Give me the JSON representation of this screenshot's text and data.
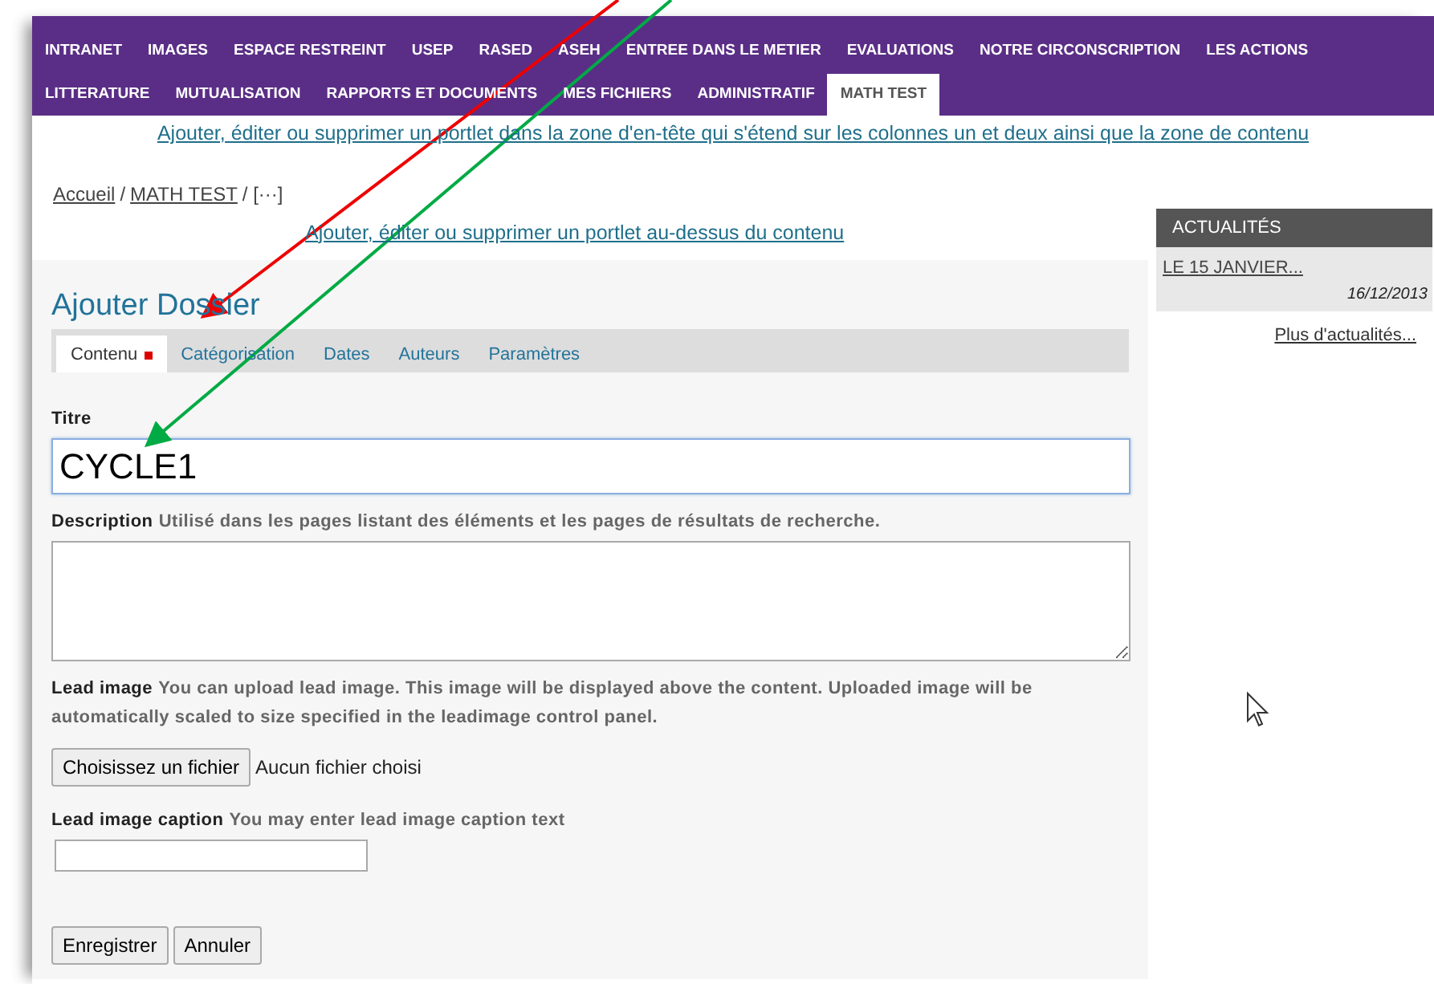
{
  "nav": {
    "row_1": [
      {
        "label": "INTRANET",
        "selected": false
      },
      {
        "label": "IMAGES",
        "selected": false
      },
      {
        "label": "ESPACE RESTREINT",
        "selected": false
      },
      {
        "label": "USEP",
        "selected": false
      },
      {
        "label": "RASED",
        "selected": false
      },
      {
        "label": "ASEH",
        "selected": false
      },
      {
        "label": "ENTREE DANS LE METIER",
        "selected": false
      },
      {
        "label": "EVALUATIONS",
        "selected": false
      },
      {
        "label": "NOTRE CIRCONSCRIPTION",
        "selected": false
      },
      {
        "label": "LES ACTIONS",
        "selected": false
      }
    ],
    "row_2": [
      {
        "label": "LITTERATURE",
        "selected": false
      },
      {
        "label": "MUTUALISATION",
        "selected": false
      },
      {
        "label": "RAPPORTS ET DOCUMENTS",
        "selected": false
      },
      {
        "label": "MES FICHIERS",
        "selected": false
      },
      {
        "label": "ADMINISTRATIF",
        "selected": false
      },
      {
        "label": "MATH TEST",
        "selected": true
      }
    ]
  },
  "header_portlet_link": "Ajouter, éditer ou supprimer un portlet dans la zone d'en-tête qui s'étend sur les colonnes un et deux ainsi que la zone de contenu",
  "breadcrumb": [
    {
      "label": "Accueil",
      "link": true
    },
    {
      "label": "/",
      "link": false
    },
    {
      "label": "MATH TEST",
      "link": true
    },
    {
      "label": "/ [···]",
      "link": false
    }
  ],
  "above_content_portlet_link": "Ajouter, éditer ou supprimer un portlet au-dessus du contenu",
  "page_title": "Ajouter Dossier",
  "form_tabs": [
    {
      "label": "Contenu",
      "selected": true,
      "required": true
    },
    {
      "label": "Catégorisation",
      "selected": false,
      "required": false
    },
    {
      "label": "Dates",
      "selected": false,
      "required": false
    },
    {
      "label": "Auteurs",
      "selected": false,
      "required": false
    },
    {
      "label": "Paramètres",
      "selected": false,
      "required": false
    }
  ],
  "fields": [
    {
      "kind": "text",
      "label": "Titre",
      "value": "CYCLE1",
      "focused": true
    },
    {
      "kind": "textarea",
      "label": "Description",
      "help": "Utilisé dans les pages listant des éléments et les pages de résultats de recherche."
    },
    {
      "kind": "file",
      "label": "Lead image",
      "help": "You can upload lead image. This image will be displayed above the content. Uploaded image will be automatically scaled to size specified in the leadimage control panel.",
      "button": "Choisissez un fichier",
      "status": "Aucun fichier choisi"
    },
    {
      "kind": "short",
      "label": "Lead image caption",
      "help": "You may enter lead image caption text"
    }
  ],
  "buttons": [
    "Enregistrer",
    "Annuler"
  ],
  "news_portlet": {
    "title": "ACTUALITÉS",
    "items": [
      {
        "title": "LE 15 JANVIER...",
        "date": "16/12/2013"
      }
    ],
    "more": "Plus d'actualités..."
  }
}
